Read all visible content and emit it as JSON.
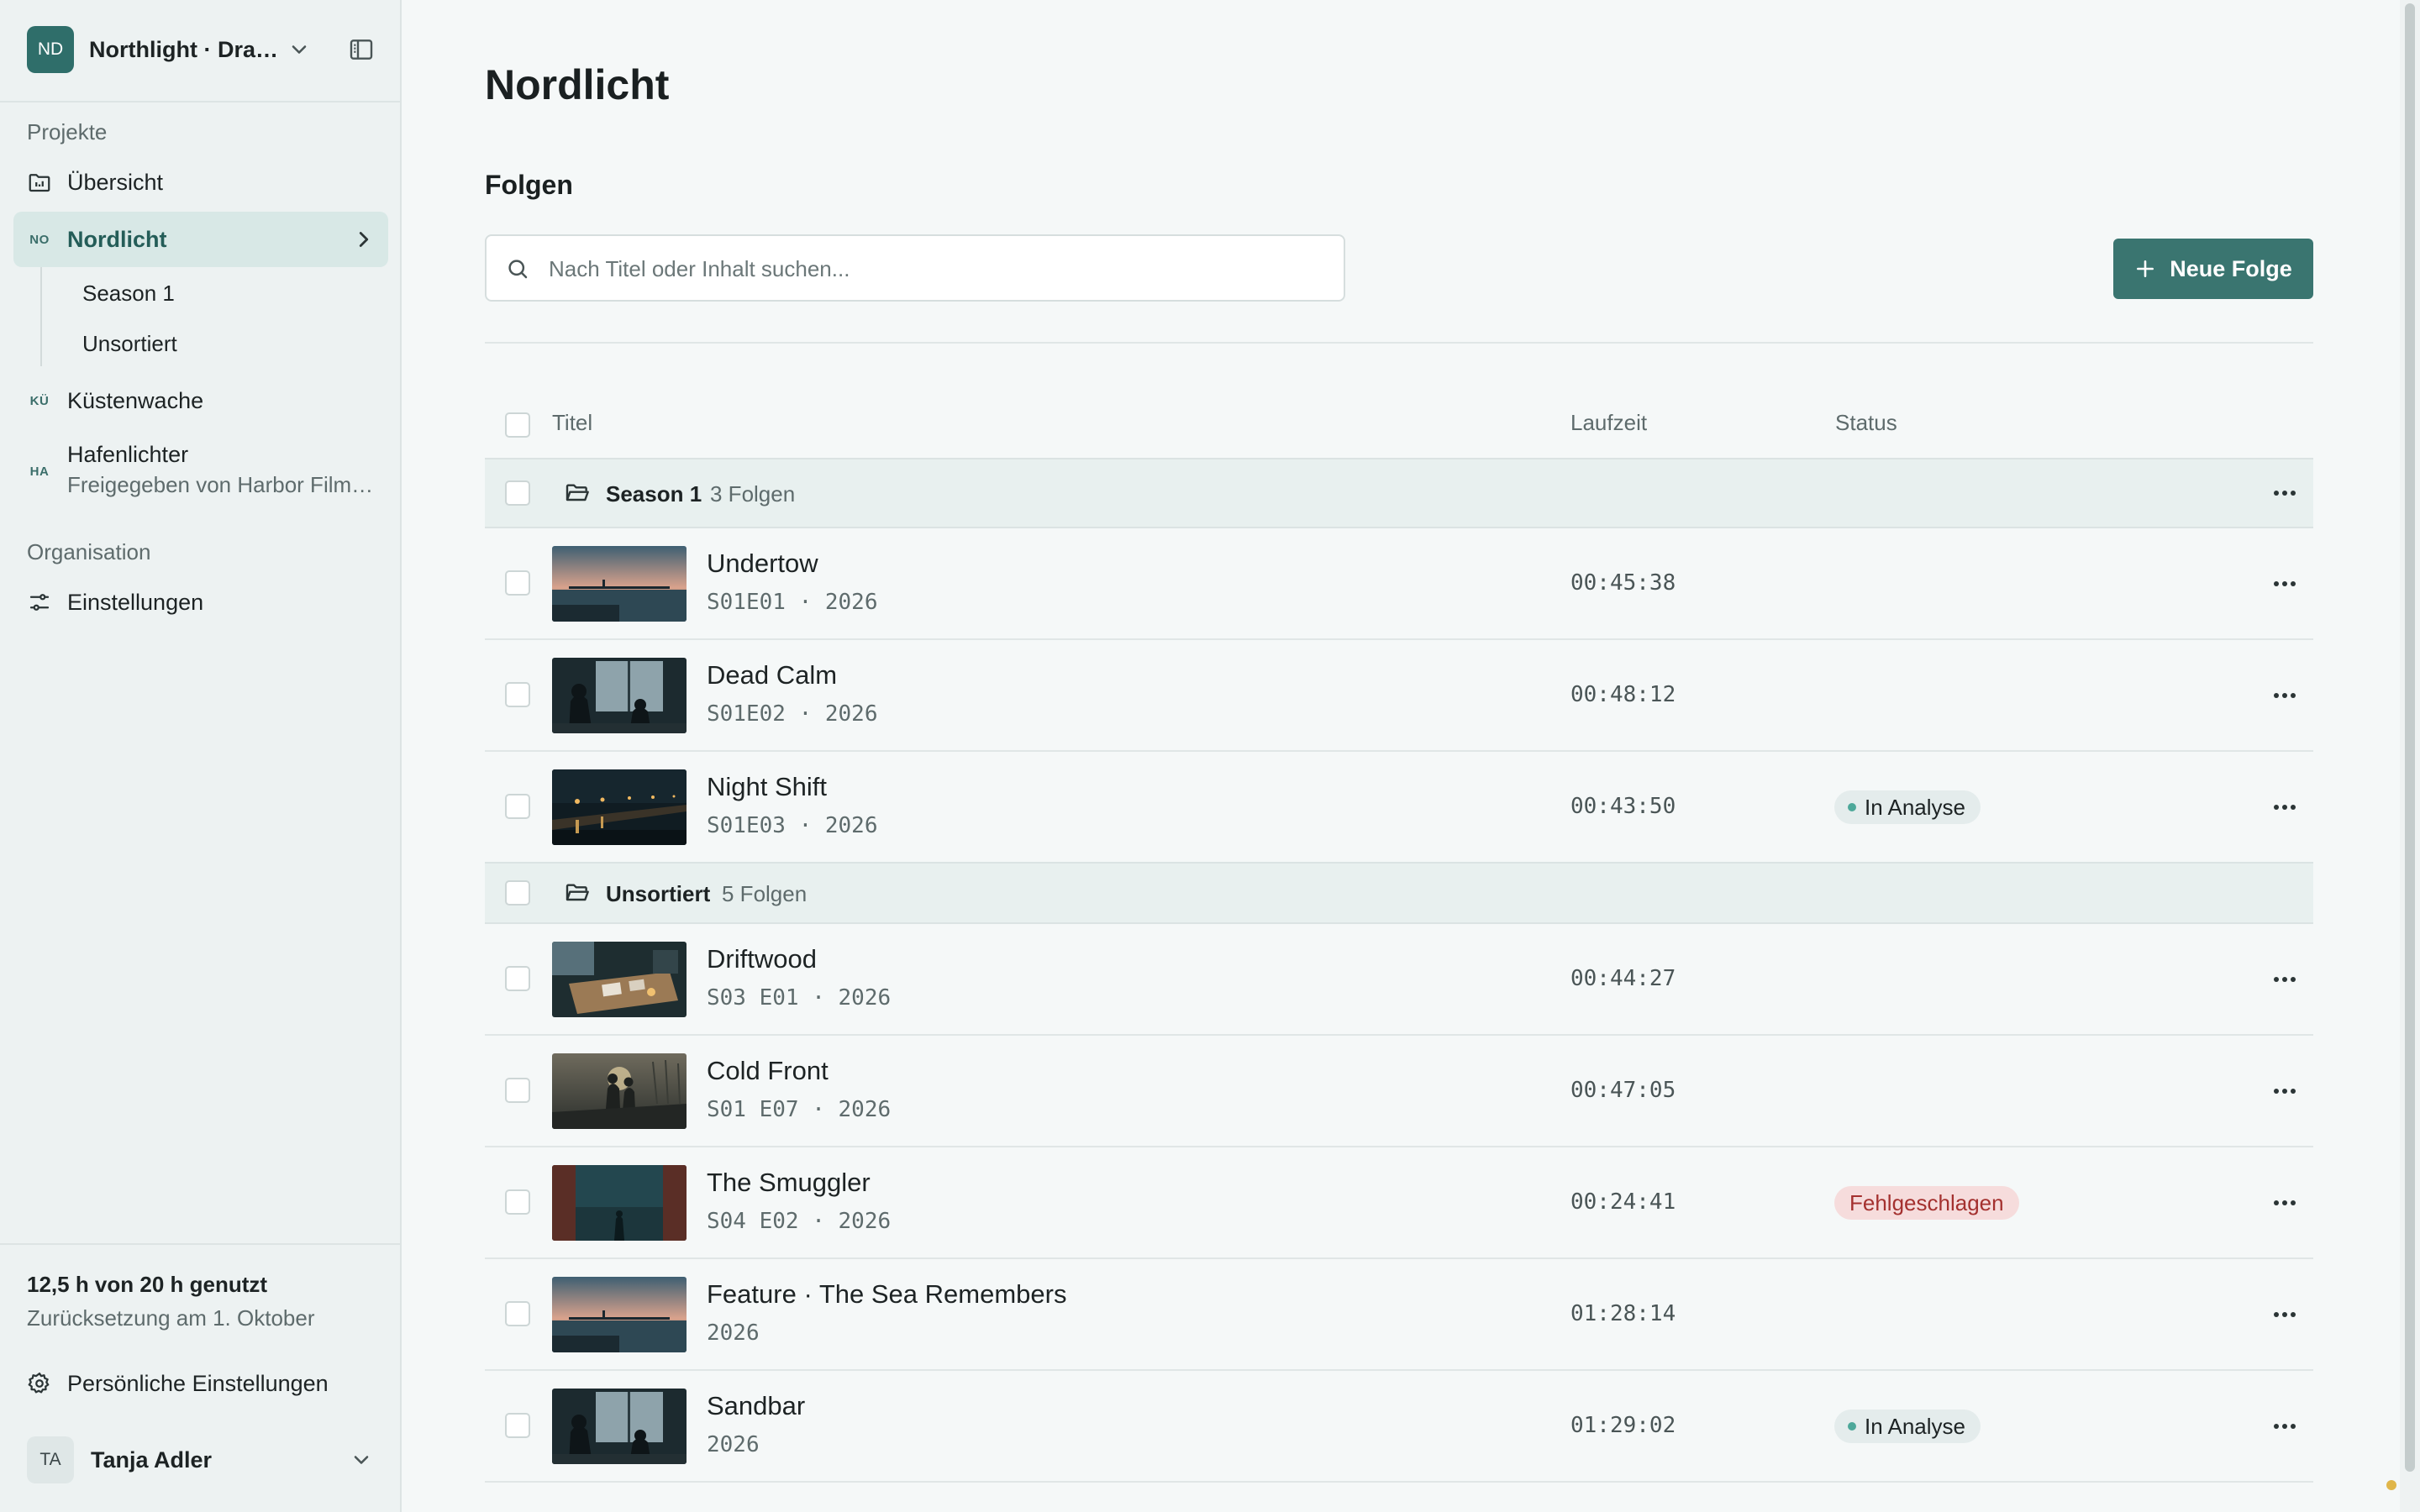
{
  "workspace": {
    "initials": "ND",
    "name": "Northlight · Drama Studio"
  },
  "sidebar": {
    "projects_label": "Projekte",
    "overview_label": "Übersicht",
    "projects": [
      {
        "badge": "NO",
        "name": "Nordlicht",
        "active": true,
        "children": [
          "Season 1",
          "Unsortiert"
        ]
      },
      {
        "badge": "KÜ",
        "name": "Küstenwache"
      },
      {
        "badge": "HA",
        "name": "Hafenlichter",
        "sub": "Freigegeben von Harbor Film Collective"
      }
    ],
    "org_label": "Organisation",
    "settings_label": "Einstellungen",
    "usage": {
      "main": "12,5 h von 20 h genutzt",
      "sub": "Zurücksetzung am 1. Oktober"
    },
    "personal_settings_label": "Persönliche Einstellungen",
    "user": {
      "initials": "TA",
      "name": "Tanja Adler"
    }
  },
  "main": {
    "title": "Nordlicht",
    "section": "Folgen",
    "search": {
      "placeholder": "Nach Titel oder Inhalt suchen...",
      "value": ""
    },
    "new_button": "Neue Folge",
    "columns": {
      "title": "Titel",
      "duration": "Laufzeit",
      "status": "Status"
    },
    "groups": [
      {
        "name": "Season 1",
        "count": "3 Folgen",
        "episodes": [
          {
            "title": "Undertow",
            "meta": "S01E01 · 2026",
            "duration": "00:45:38",
            "status": "",
            "thumb": "sunset"
          },
          {
            "title": "Dead Calm",
            "meta": "S01E02 · 2026",
            "duration": "00:48:12",
            "status": "",
            "thumb": "silhouettes"
          },
          {
            "title": "Night Shift",
            "meta": "S01E03 · 2026",
            "duration": "00:43:50",
            "status": "In Analyse",
            "status_type": "analyse",
            "thumb": "night"
          }
        ]
      },
      {
        "name": "Unsortiert",
        "count": "5 Folgen",
        "episodes": [
          {
            "title": "Driftwood",
            "meta": "S03 E01 · 2026",
            "duration": "00:44:27",
            "status": "",
            "thumb": "desk"
          },
          {
            "title": "Cold Front",
            "meta": "S01 E07 · 2026",
            "duration": "00:47:05",
            "status": "",
            "thumb": "couple"
          },
          {
            "title": "The Smuggler",
            "meta": "S04 E02 · 2026",
            "duration": "00:24:41",
            "status": "Fehlgeschlagen",
            "status_type": "failed",
            "thumb": "doorway"
          },
          {
            "title": "Feature · The Sea Remembers",
            "meta": "2026",
            "duration": "01:28:14",
            "status": "",
            "thumb": "sunset"
          },
          {
            "title": "Sandbar",
            "meta": "2026",
            "duration": "01:29:02",
            "status": "In Analyse",
            "status_type": "analyse",
            "thumb": "silhouettes"
          }
        ]
      }
    ]
  },
  "colors": {
    "accent": "#3a7570",
    "active_bg": "#d8e8e6",
    "failed_bg": "#f6dcdc",
    "failed_text": "#a4312f",
    "analyse_dot": "#4da89a"
  }
}
